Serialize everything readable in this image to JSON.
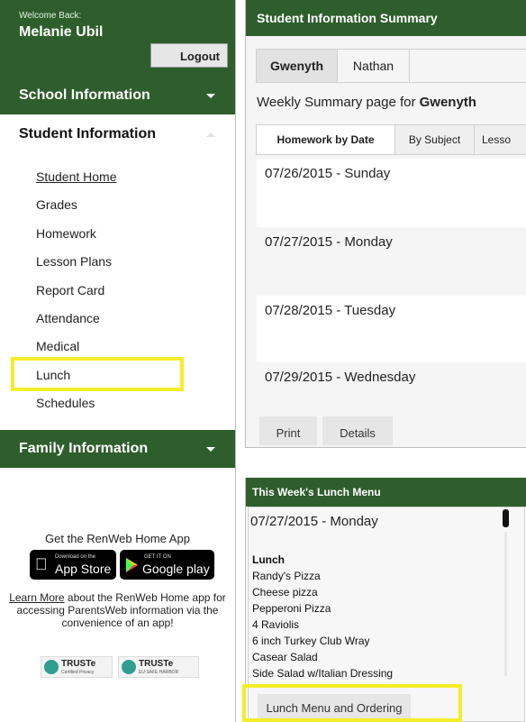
{
  "user": {
    "welcome": "Welcome Back:",
    "name": "Melanie Ubil",
    "logout_label": "Logout"
  },
  "sidebar": {
    "school_info": "School Information",
    "student_info": "Student Information",
    "family_info": "Family Information",
    "items": [
      {
        "label": "Student Home"
      },
      {
        "label": "Grades"
      },
      {
        "label": "Homework"
      },
      {
        "label": "Lesson Plans"
      },
      {
        "label": "Report Card"
      },
      {
        "label": "Attendance"
      },
      {
        "label": "Medical"
      },
      {
        "label": "Lunch"
      },
      {
        "label": "Schedules"
      }
    ],
    "app_promo": {
      "title": "Get the RenWeb Home App",
      "appstore_small": "Download on the",
      "appstore_big": "App Store",
      "googleplay_small": "GET IT ON",
      "googleplay_big": "Google play",
      "learn_more": "Learn More",
      "learn_text": " about the RenWeb Home app for accessing ParentsWeb information via the convenience of an app!",
      "truste1": "TRUSTe",
      "truste1_sub": "Certified Privacy",
      "truste2": "TRUSTe",
      "truste2_sub": "EU SAFE HARBOR"
    }
  },
  "summary": {
    "title": "Student Information Summary",
    "students": [
      "Gwenyth",
      "Nathan"
    ],
    "weekly_prefix": "Weekly Summary page for ",
    "weekly_name": "Gwenyth",
    "subtabs": [
      "Homework by Date",
      "By Subject",
      "Lesso"
    ],
    "days": [
      "07/26/2015 - Sunday",
      "07/27/2015 - Monday",
      "07/28/2015 - Tuesday",
      "07/29/2015 - Wednesday"
    ],
    "print_label": "Print",
    "details_label": "Details"
  },
  "lunch": {
    "title": "This Week's Lunch Menu",
    "date": "07/27/2015 - Monday",
    "label": "Lunch",
    "items": [
      "Randy's Pizza",
      "Cheese pizza",
      "Pepperoni Pizza",
      "4 Raviolis",
      "6 inch Turkey Club Wray",
      "Casear Salad",
      "Side Salad w/Italian Dressing"
    ],
    "order_label": "Lunch Menu and Ordering"
  },
  "colors": {
    "brand_green": "#2e5e2c",
    "highlight_yellow": "#f3ee2a"
  }
}
